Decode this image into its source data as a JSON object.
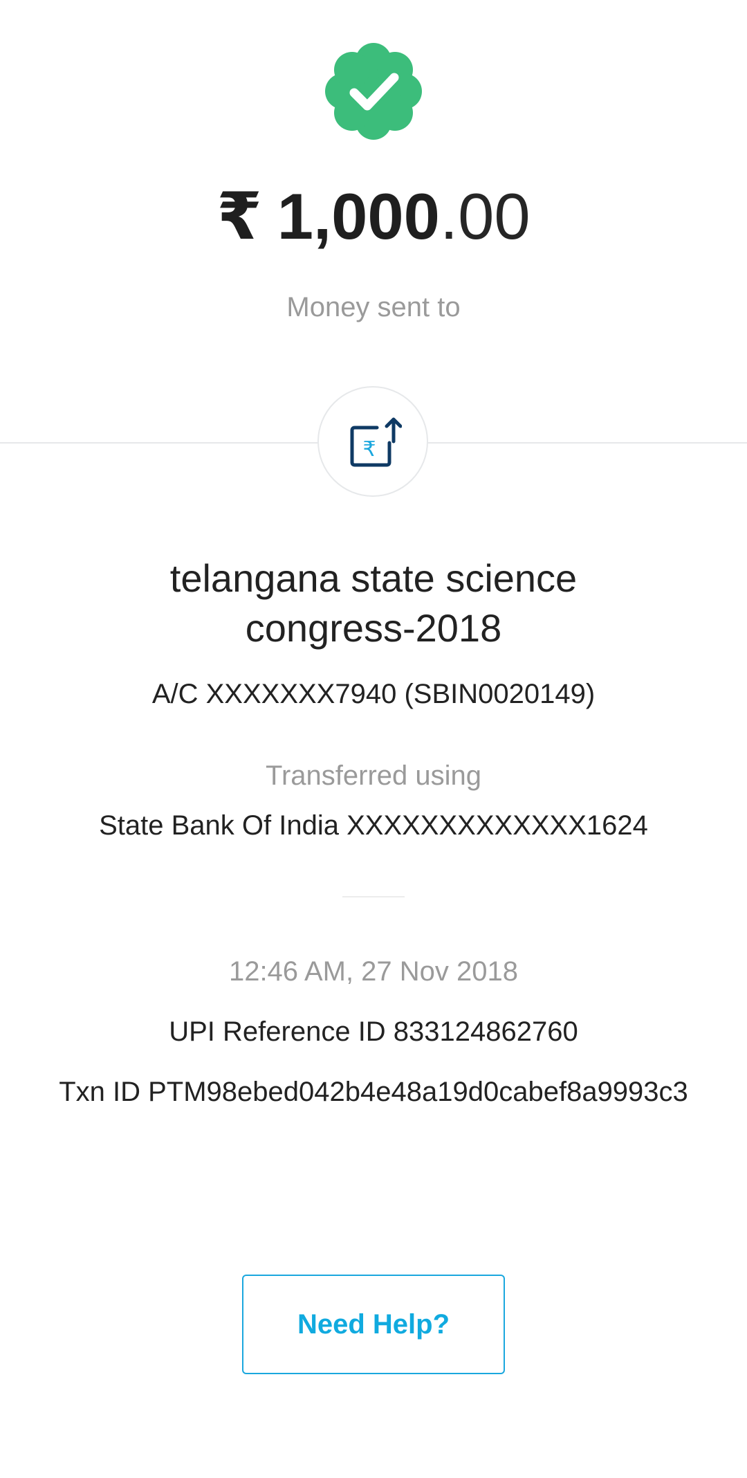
{
  "status": {
    "icon": "verified-check-badge-icon",
    "color": "#3cbd7b"
  },
  "amount": {
    "currency_symbol": "₹",
    "whole": "1,000",
    "decimal": ".00"
  },
  "money_sent_label": "Money sent to",
  "transfer_icon": "rupee-transfer-out-icon",
  "payee": {
    "name": "telangana state science congress-2018",
    "account": "A/C XXXXXXX7940 (SBIN0020149)"
  },
  "source": {
    "label": "Transferred using",
    "bank": "State Bank Of India XXXXXXXXXXXXX1624"
  },
  "transaction": {
    "timestamp": "12:46 AM, 27 Nov 2018",
    "upi_reference": "UPI Reference ID 833124862760",
    "txn_id": "Txn ID PTM98ebed042b4e48a19d0cabef8a9993c3"
  },
  "help_button_label": "Need Help?",
  "colors": {
    "success_green": "#3cbd7b",
    "accent_blue": "#10aadf",
    "icon_navy": "#0f3a64",
    "muted_text": "#9a9a9a"
  }
}
